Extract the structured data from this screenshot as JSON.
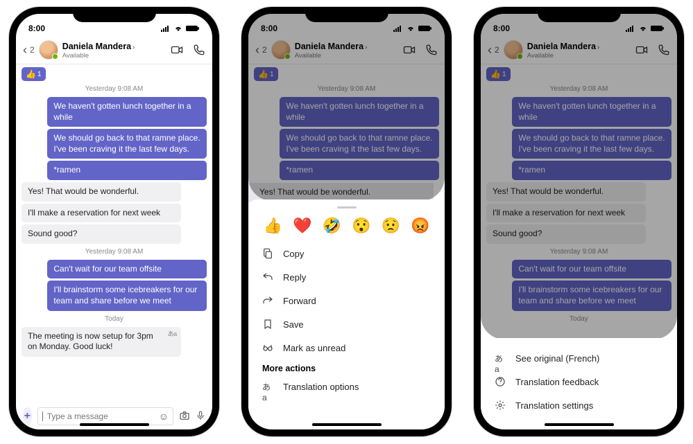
{
  "status": {
    "time": "8:00"
  },
  "header": {
    "back_count": "2",
    "name": "Daniela Mandera",
    "presence_text": "Available"
  },
  "timestamps": {
    "ts1": "Yesterday 9:08 AM",
    "ts2": "Yesterday 9:08 AM",
    "today": "Today"
  },
  "messages": {
    "thumbs_count": "1",
    "m1": "We haven't gotten lunch together in a while",
    "m2": "We should go back to that ramne place. I've been craving it the last few days.",
    "m3": "*ramen",
    "r1": "Yes! That would be wonderful.",
    "r2": "I'll make a reservation for next week",
    "r3": "Sound good?",
    "m4": "Can't wait for our team offsite",
    "m5": "I'll brainstorm some icebreakers for our team and share before we meet",
    "r4": "The meeting is now setup for 3pm on Monday. Good luck!",
    "translated_badge": "あa"
  },
  "compose": {
    "placeholder": "Type a message"
  },
  "reactions": {
    "thumbs": "👍",
    "heart": "❤️",
    "laugh": "🤣",
    "wow": "😯",
    "sad": "😟",
    "angry": "😡"
  },
  "menu_phone2": {
    "copy": "Copy",
    "reply": "Reply",
    "forward": "Forward",
    "save": "Save",
    "unread": "Mark as unread",
    "more_header": "More actions",
    "translation": "Translation options"
  },
  "menu_phone3": {
    "see_original": "See original (French)",
    "feedback": "Translation feedback",
    "settings": "Translation settings"
  }
}
